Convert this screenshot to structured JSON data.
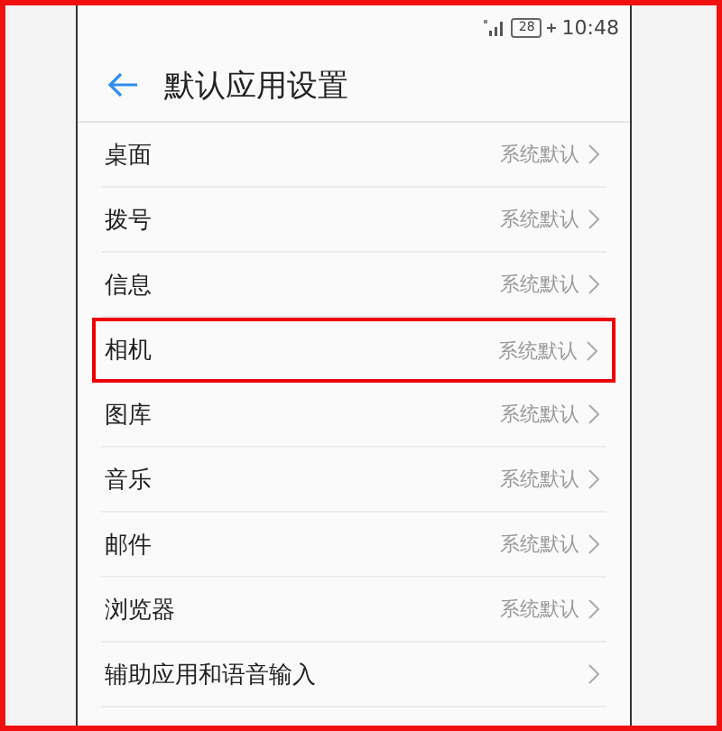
{
  "status_bar": {
    "battery": "28",
    "time": "10:48"
  },
  "header": {
    "title": "默认应用设置"
  },
  "items": [
    {
      "label": "桌面",
      "value": "系统默认",
      "highlighted": false
    },
    {
      "label": "拨号",
      "value": "系统默认",
      "highlighted": false
    },
    {
      "label": "信息",
      "value": "系统默认",
      "highlighted": false
    },
    {
      "label": "相机",
      "value": "系统默认",
      "highlighted": true
    },
    {
      "label": "图库",
      "value": "系统默认",
      "highlighted": false
    },
    {
      "label": "音乐",
      "value": "系统默认",
      "highlighted": false
    },
    {
      "label": "邮件",
      "value": "系统默认",
      "highlighted": false
    },
    {
      "label": "浏览器",
      "value": "系统默认",
      "highlighted": false
    },
    {
      "label": "辅助应用和语音输入",
      "highlighted": false
    }
  ]
}
